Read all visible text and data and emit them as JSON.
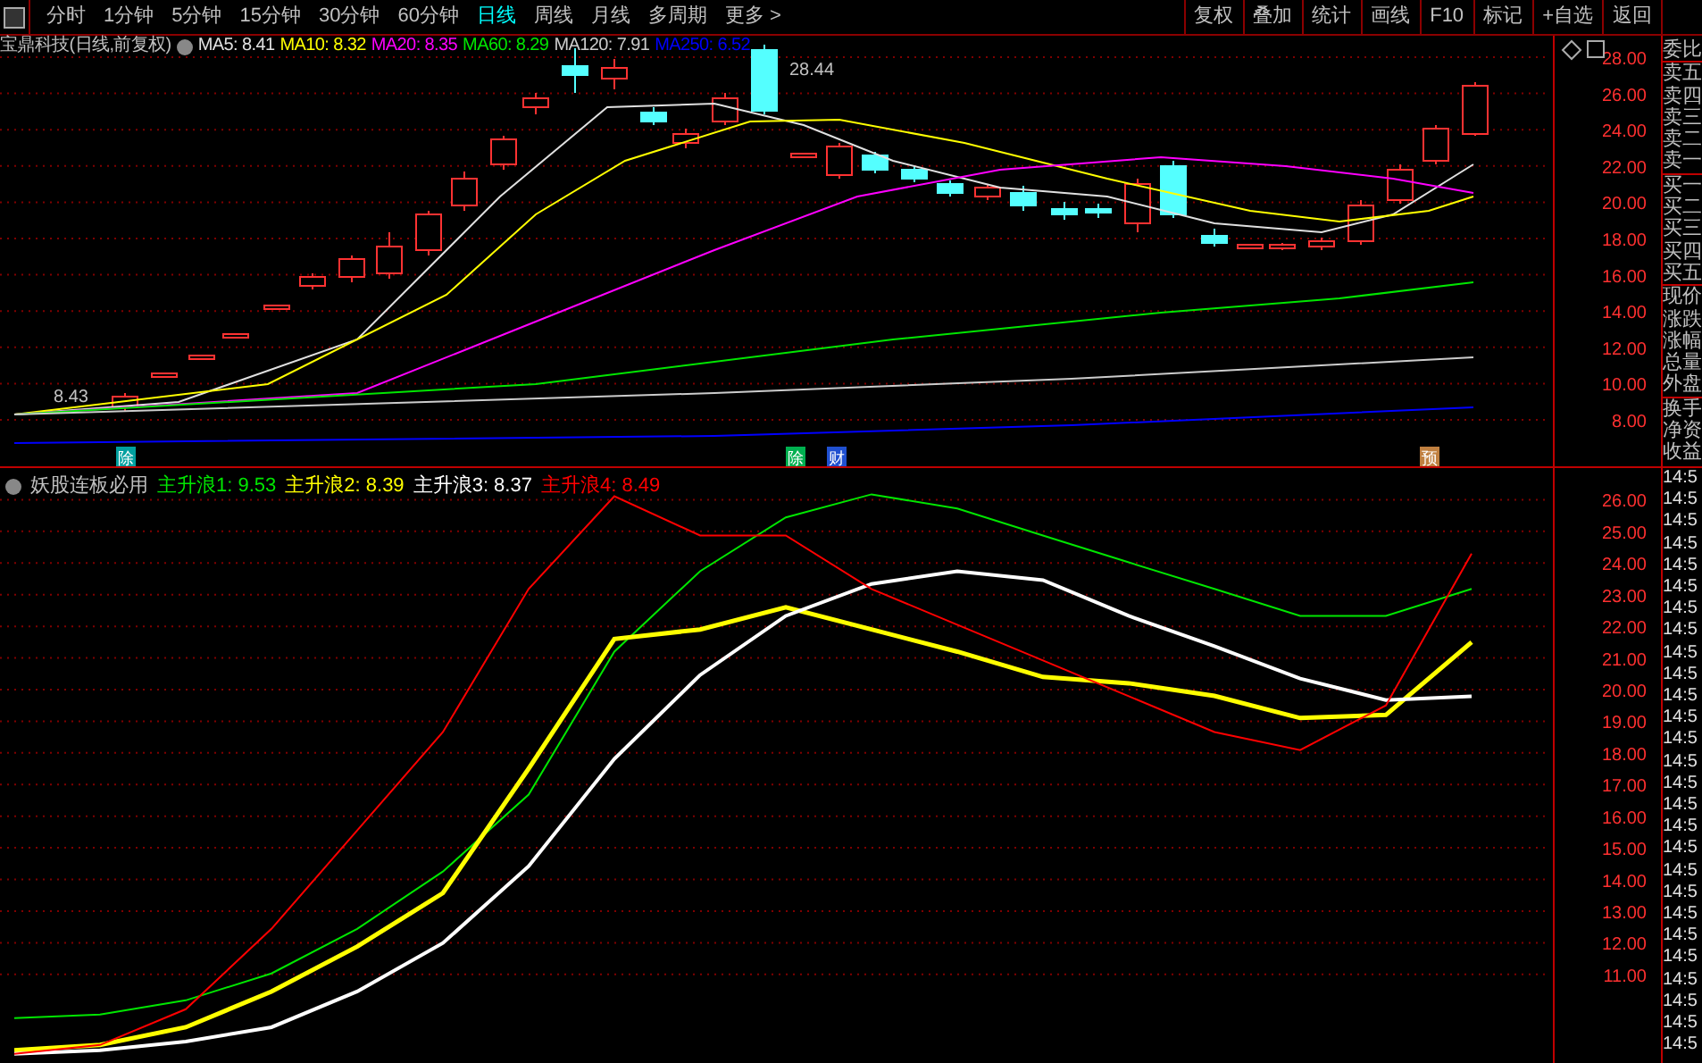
{
  "toolbar": {
    "periods": [
      {
        "label": "分时",
        "selected": false
      },
      {
        "label": "1分钟",
        "selected": false
      },
      {
        "label": "5分钟",
        "selected": false
      },
      {
        "label": "15分钟",
        "selected": false
      },
      {
        "label": "30分钟",
        "selected": false
      },
      {
        "label": "60分钟",
        "selected": false
      },
      {
        "label": "日线",
        "selected": true
      },
      {
        "label": "周线",
        "selected": false
      },
      {
        "label": "月线",
        "selected": false
      },
      {
        "label": "多周期",
        "selected": false
      },
      {
        "label": "更多 >",
        "selected": false
      }
    ],
    "buttons": [
      "复权",
      "叠加",
      "统计",
      "画线",
      "F10",
      "标记",
      "+自选",
      "返回"
    ]
  },
  "price_panel": {
    "title": "宝鼎科技(日线,前复权)",
    "indicators": [
      {
        "label": "MA5: 8.41",
        "color": "#e0e0e0"
      },
      {
        "label": "MA10: 8.32",
        "color": "#ffff00"
      },
      {
        "label": "MA20: 8.35",
        "color": "#ff00ff"
      },
      {
        "label": "MA60: 8.29",
        "color": "#00e600"
      },
      {
        "label": "MA120: 7.91",
        "color": "#cccccc"
      },
      {
        "label": "MA250: 6.52",
        "color": "#0000ff"
      }
    ],
    "price_axis": [
      "28.00",
      "26.00",
      "24.00",
      "22.00",
      "20.00",
      "18.00",
      "16.00",
      "14.00",
      "12.00",
      "10.00",
      "8.00"
    ],
    "high_label": "28.44",
    "low_label": "8.43",
    "event_marks": [
      {
        "label": "除",
        "color": "#00a0a0"
      },
      {
        "label": "除",
        "color": "#00b050"
      },
      {
        "label": "财",
        "color": "#2050d0"
      },
      {
        "label": "预",
        "color": "#c08040"
      }
    ]
  },
  "indicator_panel": {
    "title": "妖股连板必用",
    "readings": [
      ": 9.53",
      ": 8.39",
      ": 8.37",
      ": 8.49"
    ],
    "chart_data": {
      "type": "line",
      "grid": true,
      "ylim": [
        8.2,
        27
      ],
      "yticks": [
        {
          "value": 26,
          "label": "26.00"
        },
        {
          "value": 25,
          "label": "25.00"
        },
        {
          "value": 24,
          "label": "24.00"
        },
        {
          "value": 23,
          "label": "23.00"
        },
        {
          "value": 22,
          "label": "22.00"
        },
        {
          "value": 21,
          "label": "21.00"
        },
        {
          "value": 20,
          "label": "20.00"
        },
        {
          "value": 19,
          "label": "19.00"
        },
        {
          "value": 18,
          "label": "18.00"
        },
        {
          "value": 17,
          "label": "17.00"
        },
        {
          "value": 16,
          "label": "16.00"
        },
        {
          "value": 15,
          "label": "15.00"
        },
        {
          "value": 14,
          "label": "14.00"
        },
        {
          "value": 13,
          "label": "13.00"
        },
        {
          "value": 12,
          "label": "12.00"
        },
        {
          "value": 11,
          "label": "11.00"
        }
      ],
      "series": [
        {
          "name": "主升浪1",
          "color": "#00e600",
          "values": [
            9.62,
            9.73,
            10.18,
            11.03,
            12.44,
            14.25,
            16.68,
            21.2,
            23.74,
            25.44,
            26.17,
            25.72,
            24.87,
            24.02,
            23.18,
            22.33,
            22.33,
            23.18
          ]
        },
        {
          "name": "主升浪2",
          "color": "#ffff00",
          "values": [
            8.6,
            8.77,
            9.33,
            10.46,
            11.88,
            13.57,
            17.5,
            21.6,
            21.9,
            22.6,
            21.9,
            21.2,
            20.4,
            20.2,
            19.8,
            19.1,
            19.2,
            21.5
          ]
        },
        {
          "name": "主升浪3",
          "color": "#ffffff",
          "values": [
            8.49,
            8.6,
            8.88,
            9.33,
            10.46,
            11.99,
            14.42,
            17.81,
            20.46,
            22.33,
            23.34,
            23.74,
            23.46,
            22.33,
            21.37,
            20.35,
            19.67,
            19.79
          ]
        },
        {
          "name": "主升浪4",
          "color": "#ff0000",
          "values": [
            8.49,
            8.77,
            9.9,
            12.44,
            15.55,
            18.66,
            23.18,
            26.11,
            24.87,
            24.87,
            23.18,
            22.05,
            20.92,
            19.79,
            18.66,
            18.09,
            19.5,
            24.3
          ]
        }
      ]
    }
  },
  "quote_panel": {
    "fields": [
      "委比",
      "卖五",
      "卖四",
      "卖三",
      "卖二",
      "卖一",
      "买一",
      "买二",
      "买三",
      "买四",
      "买五",
      "现价",
      "涨跌",
      "涨幅",
      "总量",
      "外盘",
      "换手",
      "净资",
      "收益"
    ]
  },
  "tick_list": {
    "times": [
      "14:5",
      "14:5",
      "14:5",
      "14:5",
      "14:5",
      "14:5",
      "14:5",
      "14:5",
      "14:5",
      "14:5",
      "14:5",
      "14:5",
      "14:5",
      "14:5",
      "14:5",
      "14:5",
      "14:5",
      "14:5",
      "14:5",
      "14:5",
      "14:5",
      "14:5",
      "14:5",
      "14:5",
      "14:5",
      "14:5",
      "14:5"
    ]
  }
}
